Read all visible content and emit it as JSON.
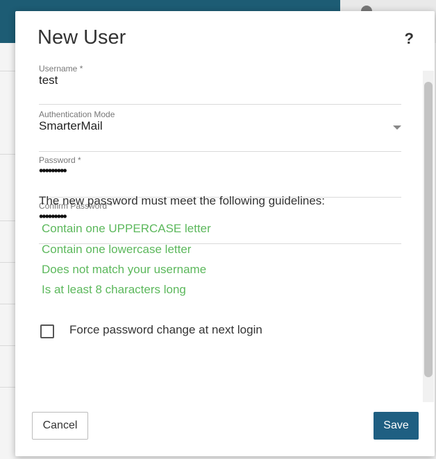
{
  "modal": {
    "title": "New User",
    "help_icon": "?"
  },
  "fields": {
    "username": {
      "label": "Username *",
      "value": "test"
    },
    "auth_mode": {
      "label": "Authentication Mode",
      "value": "SmarterMail"
    },
    "password": {
      "label": "Password *",
      "value": "•••••••••"
    },
    "confirm_password": {
      "label": "Confirm Password *",
      "value": "•••••••••"
    }
  },
  "guidelines": {
    "heading": "The new password must meet the following guidelines:",
    "rules": [
      "Contain one UPPERCASE letter",
      "Contain one lowercase letter",
      "Does not match your username",
      "Is at least 8 characters long"
    ]
  },
  "force_change": {
    "label": "Force password change at next login",
    "checked": false
  },
  "buttons": {
    "cancel": "Cancel",
    "save": "Save"
  },
  "colors": {
    "header": "#1d5c74",
    "save_button": "#1f5f82",
    "guideline_met": "#5cb85c"
  },
  "icons": {
    "help": "question-mark-icon",
    "dropdown": "caret-down-icon"
  }
}
